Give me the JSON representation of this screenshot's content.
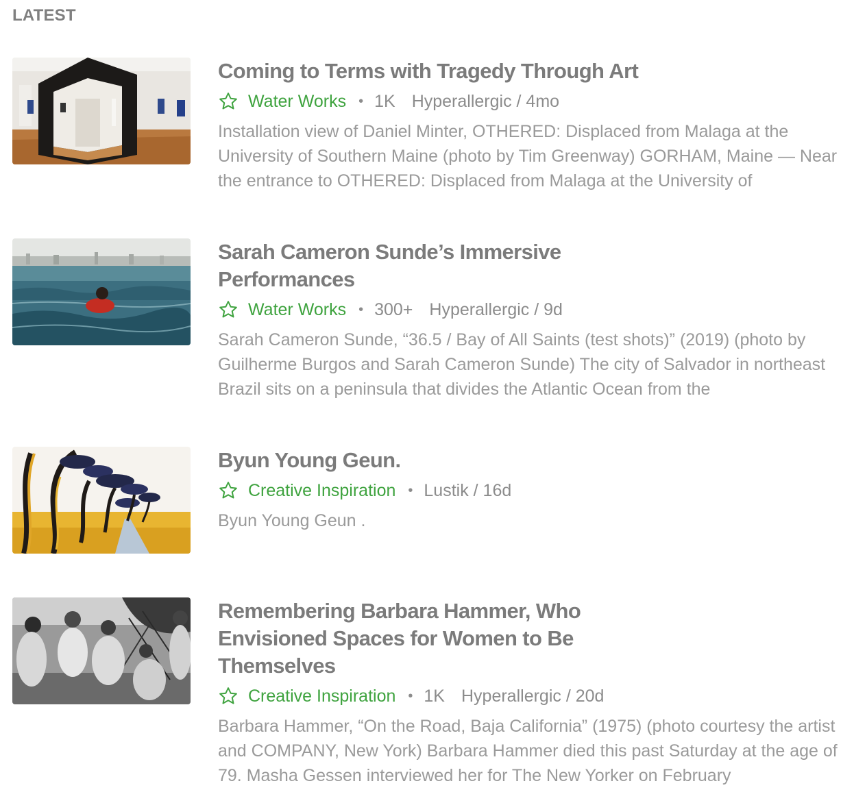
{
  "section": {
    "title": "LATEST"
  },
  "colors": {
    "feed_green": "#3fa33f",
    "title_gray": "#7b7b7b",
    "text_gray": "#9a9a9a"
  },
  "entries": [
    {
      "title": "Coming to Terms with Tragedy Through Art",
      "feed": "Water Works",
      "separator": "•",
      "count": "1K",
      "source": "Hyperallergic / 4mo",
      "summary": "Installation view of Daniel Minter, OTHERED: Displaced from Malaga at the University of Southern Maine (photo by Tim Greenway) GORHAM, Maine — Near the entrance to OTHERED: Displaced from Malaga at the University of",
      "thumb_icon": "gallery-installation-photo"
    },
    {
      "title": "Sarah Cameron Sunde’s Immersive Performances",
      "feed": "Water Works",
      "separator": "•",
      "count": "300+",
      "source": "Hyperallergic / 9d",
      "summary": "Sarah Cameron Sunde, “36.5 / Bay of All Saints (test shots)” (2019) (photo by Guilherme Burgos and Sarah Cameron Sunde) The city of Salvador in northeast Brazil sits on a peninsula that divides the Atlantic Ocean from the",
      "thumb_icon": "person-in-sea-photo"
    },
    {
      "title": "Byun Young Geun.",
      "feed": "Creative Inspiration",
      "separator": "•",
      "count": "",
      "source": "Lustik / 16d",
      "summary": "Byun Young Geun .",
      "thumb_icon": "painted-trees-artwork"
    },
    {
      "title": "Remembering Barbara Hammer, Who Envisioned Spaces for Women to Be Themselves",
      "feed": "Creative Inspiration",
      "separator": "•",
      "count": "1K",
      "source": "Hyperallergic / 20d",
      "summary": "Barbara Hammer, “On the Road, Baja California” (1975) (photo courtesy the artist and COMPANY, New York) Barbara Hammer died this past Saturday at the age of 79. Masha Gessen interviewed her for The New Yorker on February",
      "thumb_icon": "black-and-white-group-photo"
    }
  ]
}
